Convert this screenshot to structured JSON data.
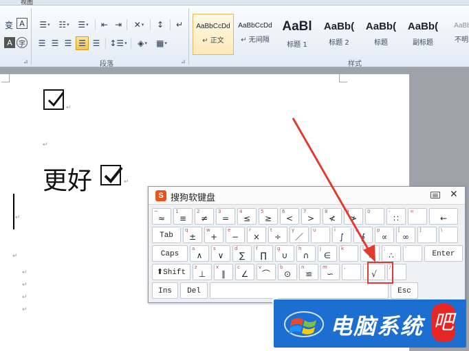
{
  "menu": {
    "view_label": "视图"
  },
  "ribbon": {
    "paragraph_group_label": "段落",
    "styles_group_label": "样式",
    "styles": [
      {
        "preview": "AaBbCcDd",
        "name": "↵ 正文",
        "size": "small",
        "selected": true
      },
      {
        "preview": "AaBbCcDd",
        "name": "↵ 无间隔",
        "size": "small",
        "selected": false
      },
      {
        "preview": "AaBl",
        "name": "标题 1",
        "size": "h1",
        "selected": false
      },
      {
        "preview": "AaBb(",
        "name": "标题 2",
        "size": "h2",
        "selected": false
      },
      {
        "preview": "AaBb(",
        "name": "标题",
        "size": "h2",
        "selected": false
      },
      {
        "preview": "AaBb(",
        "name": "副标题",
        "size": "h2",
        "selected": false
      },
      {
        "preview": "AaBbC",
        "name": "不明显",
        "size": "small",
        "selected": false
      }
    ],
    "font_icons": {
      "phonetic": "变",
      "border_char": "A",
      "char_shade": "A",
      "enclose_char": "字"
    },
    "paragraph_icons": {
      "bullets": "☰",
      "numbering": "☷",
      "multilevel": "☰",
      "decrease_indent": "⇤",
      "increase_indent": "⇥",
      "chinese_layout": "✕",
      "sort": "↕",
      "show_marks": "↵",
      "align_left": "☰",
      "center": "☰",
      "align_right": "☰",
      "justify": "☰",
      "distributed": "☰",
      "line_spacing": "↕☰",
      "shading": "◈",
      "borders": "▦"
    }
  },
  "document": {
    "lines": [
      {
        "type": "checkbox"
      },
      {
        "type": "empty"
      },
      {
        "type": "text",
        "text": "更好"
      }
    ],
    "pilcrow": "↵",
    "empty_mark": "↵"
  },
  "keyboard": {
    "title": "搜狗软键盘",
    "logo": "S",
    "close": "✕",
    "rows": [
      [
        {
          "shift": "~",
          "main": "≈"
        },
        {
          "shift": "1",
          "main": "≡"
        },
        {
          "shift": "2",
          "main": "≠"
        },
        {
          "shift": "3",
          "main": "="
        },
        {
          "shift": "4",
          "main": "≤"
        },
        {
          "shift": "5",
          "main": "≥"
        },
        {
          "shift": "6",
          "main": "<"
        },
        {
          "shift": "7",
          "main": ">"
        },
        {
          "shift": "8",
          "main": "≮"
        },
        {
          "shift": "9",
          "main": "≯"
        },
        {
          "shift": "0",
          "main": ""
        },
        {
          "shift": "-",
          "main": "∷"
        },
        {
          "shift": "=",
          "main": ""
        },
        {
          "shift": "",
          "main": "←"
        }
      ],
      [
        {
          "shift": "",
          "main": "Tab"
        },
        {
          "shift": "q",
          "main": "±"
        },
        {
          "shift": "w",
          "main": "+"
        },
        {
          "shift": "e",
          "main": "−"
        },
        {
          "shift": "r",
          "main": "×"
        },
        {
          "shift": "t",
          "main": "÷"
        },
        {
          "shift": "y",
          "main": "／"
        },
        {
          "shift": "u",
          "main": ""
        },
        {
          "shift": "i",
          "main": "∫"
        },
        {
          "shift": "o",
          "main": "∮"
        },
        {
          "shift": "p",
          "main": "∝"
        },
        {
          "shift": "[",
          "main": "∞"
        },
        {
          "shift": "]",
          "main": ""
        },
        {
          "shift": "\\",
          "main": ""
        }
      ],
      [
        {
          "shift": "",
          "main": "Caps"
        },
        {
          "shift": "a",
          "main": "∧"
        },
        {
          "shift": "s",
          "main": "∨"
        },
        {
          "shift": "d",
          "main": "∑"
        },
        {
          "shift": "f",
          "main": "∏"
        },
        {
          "shift": "g",
          "main": "∪"
        },
        {
          "shift": "h",
          "main": "∩"
        },
        {
          "shift": "j",
          "main": "∈"
        },
        {
          "shift": "k",
          "main": ""
        },
        {
          "shift": "l",
          "main": "∵"
        },
        {
          "shift": ";",
          "main": "∴"
        },
        {
          "shift": "'",
          "main": ""
        },
        {
          "shift": "",
          "main": "Enter"
        }
      ],
      [
        {
          "shift": "",
          "main": "⬆Shift"
        },
        {
          "shift": "z",
          "main": "⊥"
        },
        {
          "shift": "x",
          "main": "∥"
        },
        {
          "shift": "c",
          "main": "∠"
        },
        {
          "shift": "v",
          "main": "⌒"
        },
        {
          "shift": "b",
          "main": "⊙"
        },
        {
          "shift": "n",
          "main": "≌"
        },
        {
          "shift": "m",
          "main": "∽"
        },
        {
          "shift": ",",
          "main": ""
        },
        {
          "shift": ".",
          "main": "√"
        },
        {
          "shift": "/",
          "main": ""
        }
      ],
      [
        {
          "shift": "",
          "main": "Ins"
        },
        {
          "shift": "",
          "main": "Del"
        },
        {
          "shift": "",
          "main": ""
        },
        {
          "shift": "",
          "main": "Esc"
        }
      ]
    ],
    "highlighted_key": "√"
  },
  "watermark": {
    "text": "电脑系统",
    "badge": "吧"
  },
  "colors": {
    "accent_red": "#e23b2e",
    "watermark_blue": "#1c6fd1"
  }
}
